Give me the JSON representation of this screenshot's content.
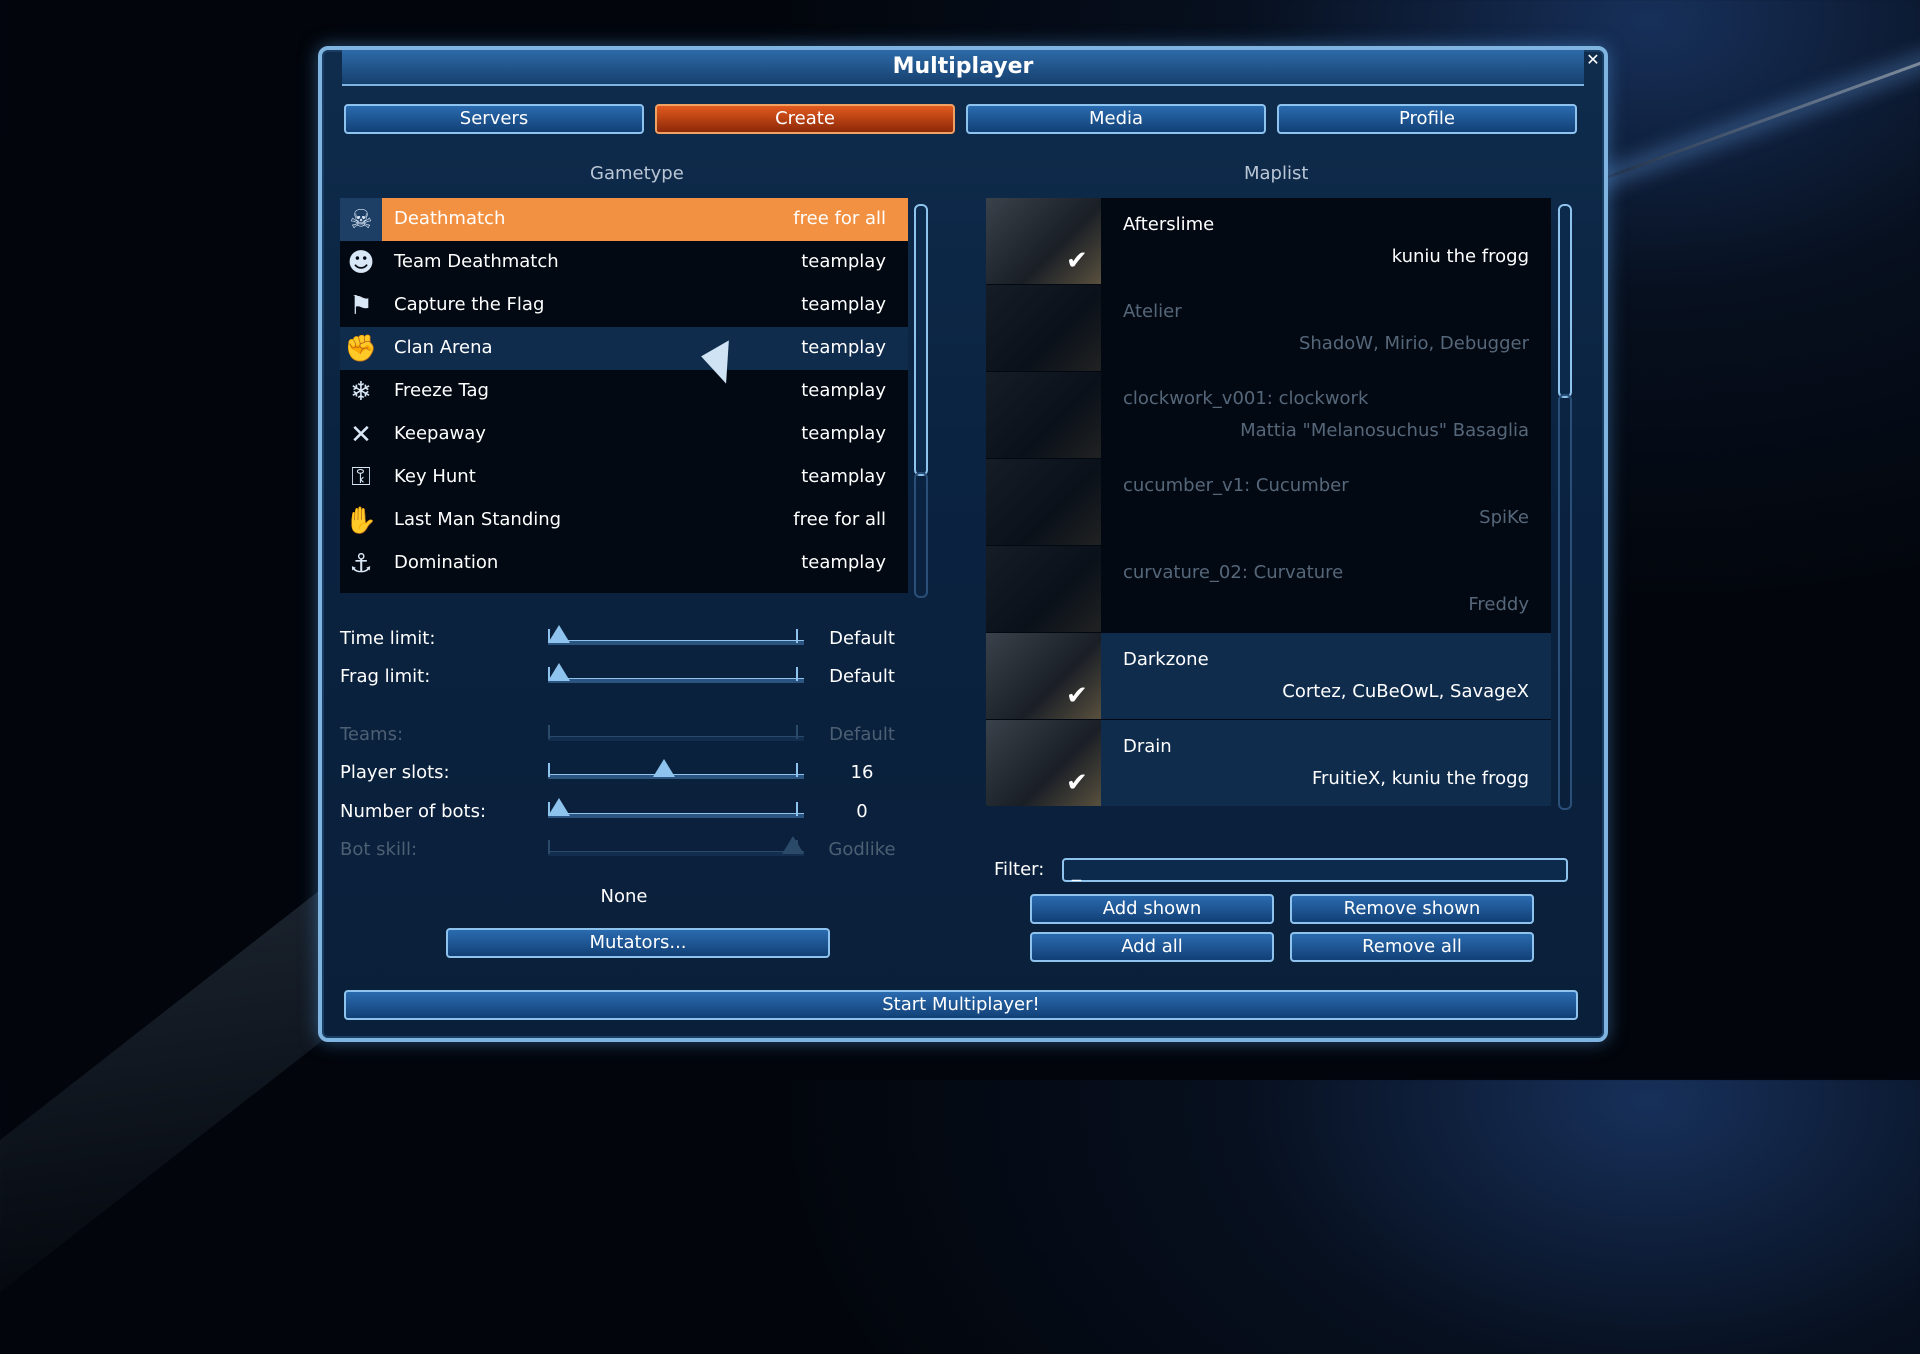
{
  "window": {
    "title": "Multiplayer"
  },
  "tabs": [
    {
      "label": "Servers"
    },
    {
      "label": "Create",
      "active": true
    },
    {
      "label": "Media"
    },
    {
      "label": "Profile"
    }
  ],
  "gametype": {
    "heading": "Gametype",
    "items": [
      {
        "name": "Deathmatch",
        "type": "free for all",
        "icon": "deathmatch-icon",
        "glyph": "☠",
        "selected": true
      },
      {
        "name": "Team Deathmatch",
        "type": "teamplay",
        "icon": "team-deathmatch-icon",
        "glyph": "☻"
      },
      {
        "name": "Capture the Flag",
        "type": "teamplay",
        "icon": "flag-icon",
        "glyph": "⚑"
      },
      {
        "name": "Clan Arena",
        "type": "teamplay",
        "icon": "clan-arena-icon",
        "glyph": "✊",
        "hover": true
      },
      {
        "name": "Freeze Tag",
        "type": "teamplay",
        "icon": "freeze-tag-icon",
        "glyph": "❄"
      },
      {
        "name": "Keepaway",
        "type": "teamplay",
        "icon": "keepaway-icon",
        "glyph": "✕"
      },
      {
        "name": "Key Hunt",
        "type": "teamplay",
        "icon": "key-icon",
        "glyph": "⚿"
      },
      {
        "name": "Last Man Standing",
        "type": "free for all",
        "icon": "last-man-standing-icon",
        "glyph": "✋"
      },
      {
        "name": "Domination",
        "type": "teamplay",
        "icon": "domination-icon",
        "glyph": "⚓"
      }
    ]
  },
  "settings": {
    "time_limit": {
      "label": "Time limit:",
      "value": "Default",
      "level": 0
    },
    "frag_limit": {
      "label": "Frag limit:",
      "value": "Default",
      "level": 0
    },
    "teams": {
      "label": "Teams:",
      "value": "Default",
      "disabled": true
    },
    "player_slots": {
      "label": "Player slots:",
      "value": "16",
      "level": 0.45
    },
    "bots": {
      "label": "Number of bots:",
      "value": "0",
      "level": 0
    },
    "bot_skill": {
      "label": "Bot skill:",
      "value": "Godlike",
      "disabled": true,
      "level": 1
    },
    "mutators_summary": "None",
    "mutators_button": "Mutators..."
  },
  "maplist": {
    "heading": "Maplist",
    "items": [
      {
        "name": "Afterslime",
        "author": "kuniu the frogg",
        "state": "selected",
        "checked": true
      },
      {
        "name": "Atelier",
        "author": "ShadoW, Mirio, Debugger",
        "state": "off"
      },
      {
        "name": "clockwork_v001: clockwork",
        "author": "Mattia \"Melanosuchus\" Basaglia",
        "state": "off"
      },
      {
        "name": "cucumber_v1: Cucumber",
        "author": "SpiKe",
        "state": "off"
      },
      {
        "name": "curvature_02: Curvature",
        "author": "Freddy",
        "state": "off"
      },
      {
        "name": "Darkzone",
        "author": "Cortez, CuBeOwL, SavageX",
        "state": "inc",
        "checked": true
      },
      {
        "name": "Drain",
        "author": "FruitieX, kuniu the frogg",
        "state": "inc",
        "checked": true
      }
    ],
    "filter_label": "Filter:",
    "filter_value": "_"
  },
  "buttons": {
    "add_shown": "Add shown",
    "remove_shown": "Remove shown",
    "add_all": "Add all",
    "remove_all": "Remove all",
    "start": "Start Multiplayer!"
  },
  "colors": {
    "accent": "#f39142",
    "frame": "#8ec3ee"
  }
}
